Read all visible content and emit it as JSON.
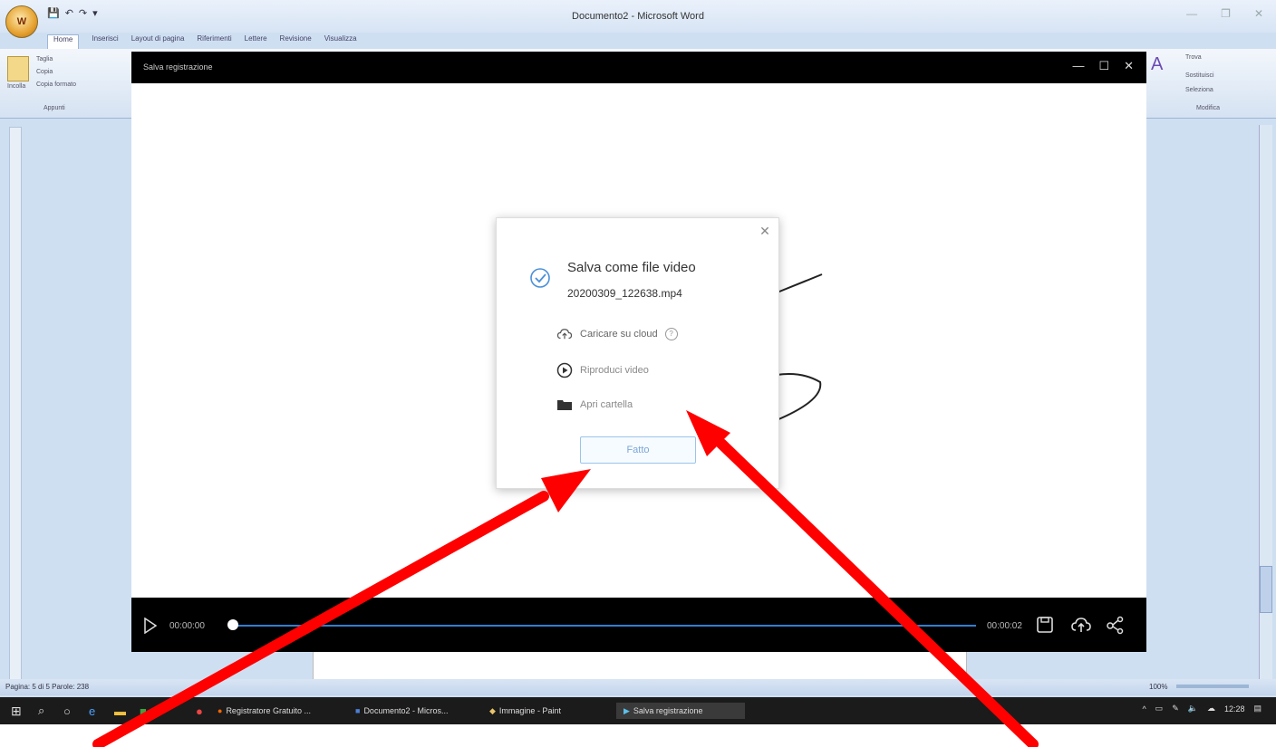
{
  "word": {
    "window_title": "Documento2 - Microsoft Word",
    "office_button": "W",
    "qat": [
      "💾",
      "↶",
      "↷",
      "▾"
    ],
    "tabs": [
      "Home",
      "Inserisci",
      "Layout di pagina",
      "Riferimenti",
      "Lettere",
      "Revisione",
      "Visualizza"
    ],
    "clipboard": {
      "paste": "Incolla",
      "cut": "Taglia",
      "copy": "Copia",
      "format_painter": "Copia formato",
      "group": "Appunti"
    },
    "editing": {
      "find": "Trova",
      "replace": "Sostituisci",
      "select": "Seleziona",
      "group": "Modifica"
    },
    "status_left": "Pagina: 5 di 5   Parole: 238",
    "zoom": "100%"
  },
  "recorder": {
    "title": "Salva registrazione",
    "time_start": "00:00:00",
    "time_end": "00:00:02"
  },
  "modal": {
    "title": "Salva come file video",
    "file_name": "20200309_122638.mp4",
    "cloud_label": "Caricare su cloud",
    "play_label": "Riproduci video",
    "folder_label": "Apri cartella",
    "done_label": "Fatto"
  },
  "taskbar": {
    "items": [
      "Registratore Gratuito ...",
      "Documento2 - Micros...",
      "Immagine - Paint",
      "Salva registrazione"
    ],
    "time": "12:28"
  },
  "colors": {
    "accent": "#2f7fd1",
    "arrow": "#ff0000"
  }
}
